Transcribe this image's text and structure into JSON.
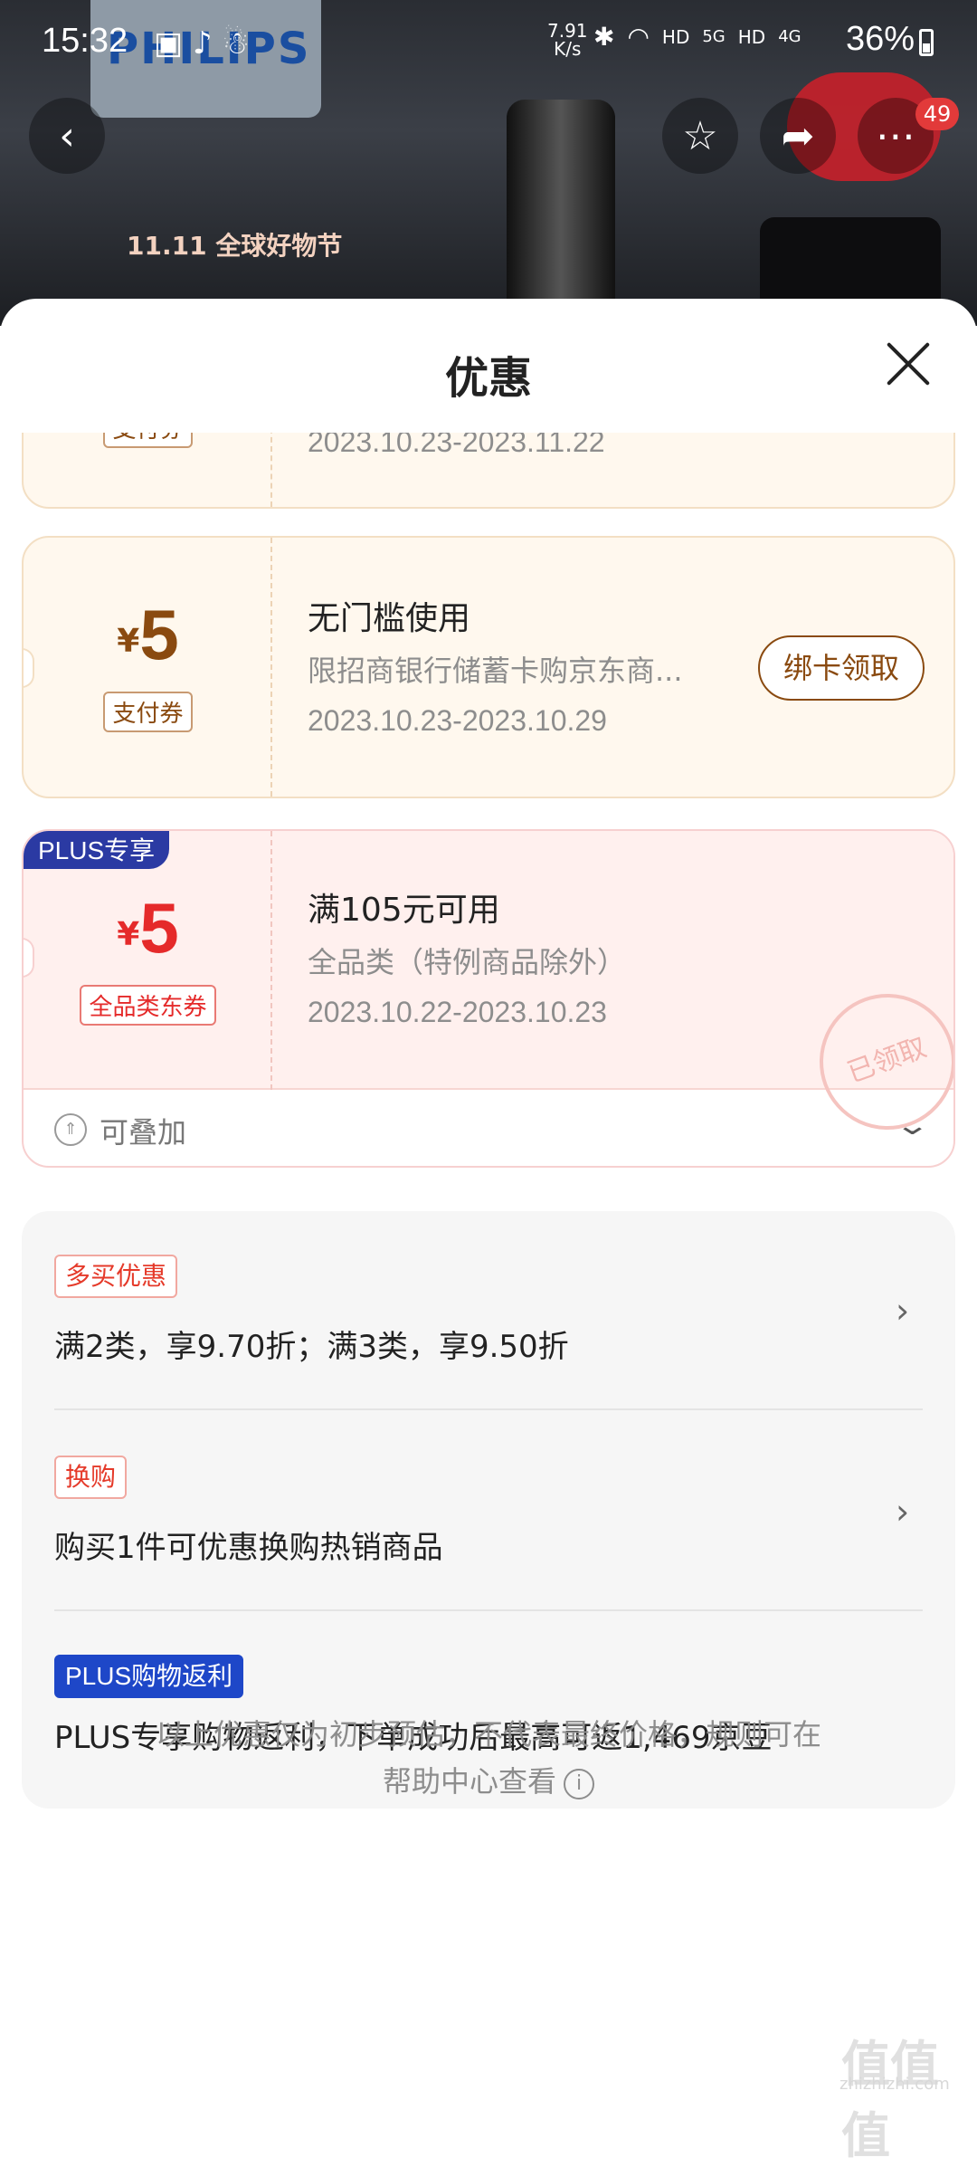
{
  "status_bar": {
    "time": "15:32",
    "speed": "7.91",
    "speed_unit": "K/s",
    "net1": "HD",
    "net2": "5G",
    "net3": "HD",
    "net4": "4G",
    "battery": "36%"
  },
  "hero": {
    "brand": "PHILIPS",
    "event": "11.11 全球好物节",
    "cart_count": "49"
  },
  "sheet": {
    "title": "优惠"
  },
  "coupons": [
    {
      "type_label": "支付券",
      "date": "2023.10.23-2023.11.22"
    },
    {
      "currency": "¥",
      "amount": "5",
      "type_label": "支付券",
      "title": "无门槛使用",
      "desc": "限招商银行储蓄卡购京东商...",
      "date": "2023.10.23-2023.10.29",
      "action": "绑卡领取"
    },
    {
      "tag": "PLUS专享",
      "currency": "¥",
      "amount": "5",
      "type_label": "全品类东券",
      "title": "满105元可用",
      "desc": "全品类（特例商品除外）",
      "date": "2023.10.22-2023.10.23",
      "stamp": "已领取",
      "stack_label": "可叠加"
    }
  ],
  "promotions": [
    {
      "tag": "多买优惠",
      "text": "满2类，享9.70折；满3类，享9.50折"
    },
    {
      "tag": "换购",
      "text": "购买1件可优惠换购热销商品"
    },
    {
      "tag": "PLUS购物返利",
      "text": "PLUS专享购物返利，下单成功后最高可返1,469京豆"
    }
  ],
  "footer": {
    "line1": "以上优惠仅为初步预估，不代表最终价格，规则可在",
    "line2": "帮助中心查看"
  },
  "watermark": {
    "main": "值值值",
    "sub": "zhizhizhi.com"
  }
}
